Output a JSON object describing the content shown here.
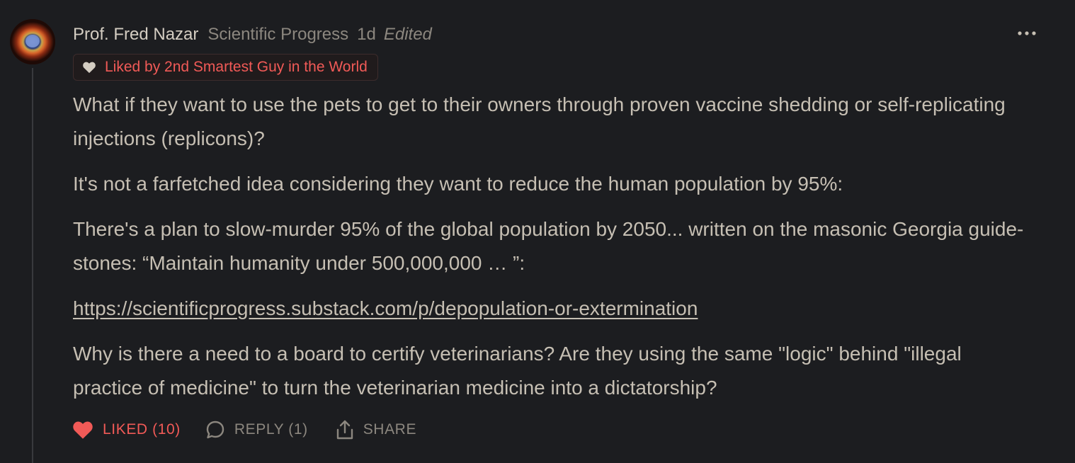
{
  "comment": {
    "author": "Prof. Fred Nazar",
    "publication": "Scientific Progress",
    "timestamp": "1d",
    "edited_label": "Edited",
    "liked_by": "Liked by 2nd Smartest Guy in the World",
    "paragraphs": [
      "What if they want to use the pets to get to their owners through proven vaccine shedding or self-replicating injections (replicons)?",
      "It's not a farfetched idea considering they want to reduce the human population by 95%:",
      "There's a plan to slow-murder 95% of the global population by 2050... written on the masonic Georgia guide-stones: “Maintain humanity under 500,000,000 … ”:",
      "Why is there a need to a board to certify veterinarians? Are they using the same \"logic\" behind \"illegal practice of medicine\" to turn the veterinarian medicine into a dictatorship?"
    ],
    "link": "https://scientificprogress.substack.com/p/depopulation-or-extermination"
  },
  "actions": {
    "like_label": "LIKED (10)",
    "reply_label": "REPLY (1)",
    "share_label": "SHARE"
  },
  "icons": {
    "avatar": "helix-nebula-avatar",
    "more": "more-horizontal-icon",
    "liked_by": "heart-icon",
    "like": "heart-filled-icon",
    "reply": "speech-bubble-icon",
    "share": "share-upload-icon"
  },
  "colors": {
    "background": "#1c1d20",
    "text": "#c6bfb3",
    "muted": "#8c877f",
    "accent_red": "#f15a57"
  }
}
